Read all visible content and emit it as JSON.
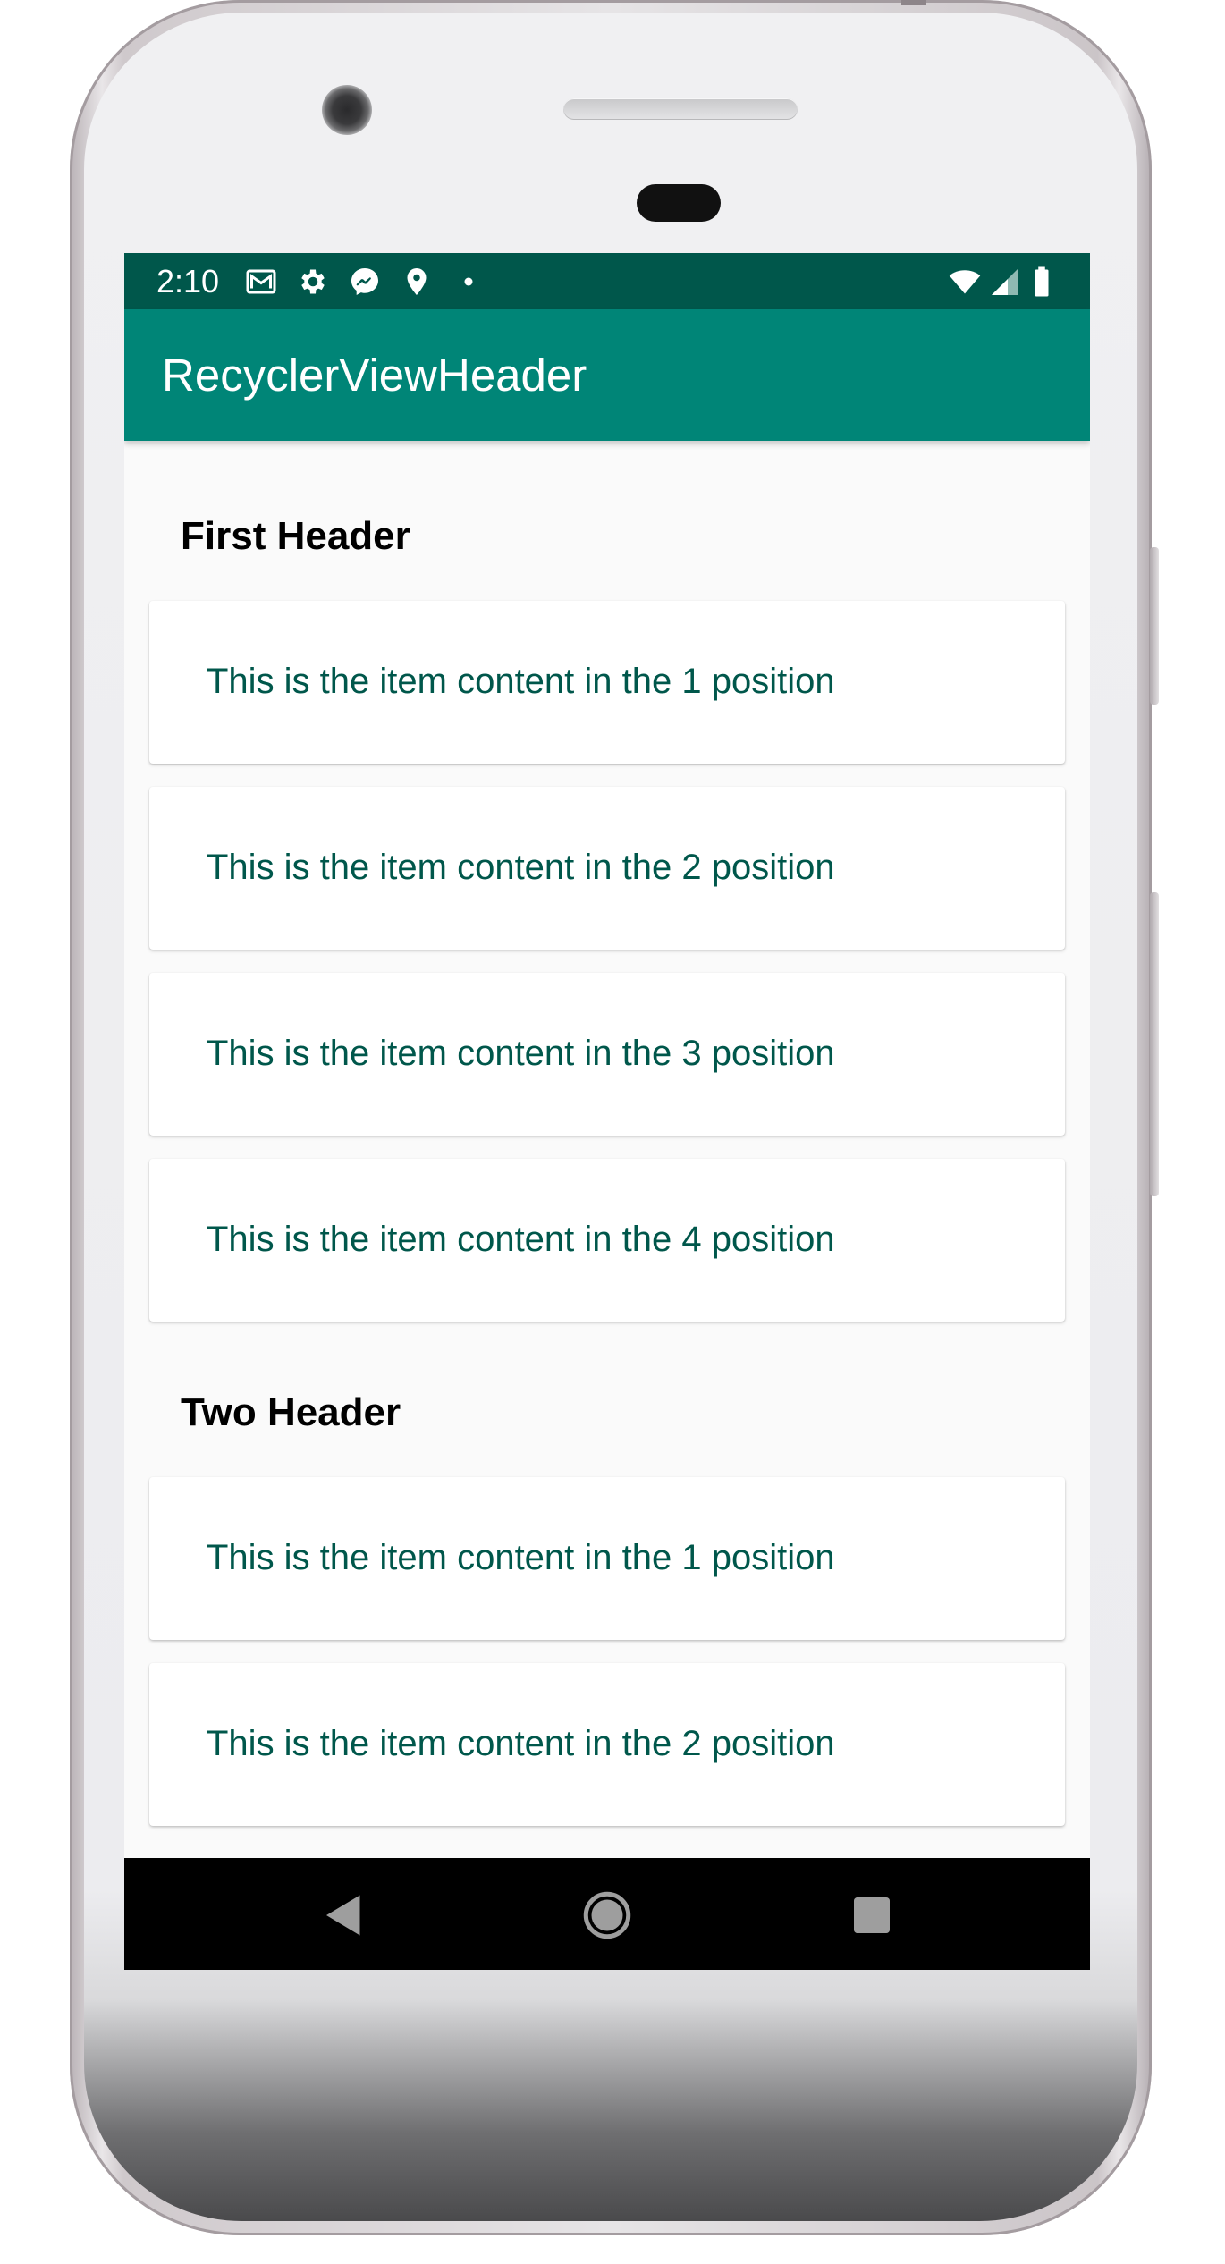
{
  "status_bar": {
    "time": "2:10",
    "left_icons": [
      "gmail-icon",
      "settings-icon",
      "messenger-icon",
      "location-icon",
      "dot-icon"
    ],
    "right_icons": [
      "wifi-icon",
      "signal-icon",
      "battery-icon"
    ],
    "background_color": "#00574b"
  },
  "app_bar": {
    "title": "RecyclerViewHeader",
    "background_color": "#008577"
  },
  "sections": [
    {
      "header": "First Header",
      "items": [
        "This is the item content in the 1 position",
        "This is the item content in the 2 position",
        "This is the item content in the 3 position",
        "This is the item content in the 4 position"
      ]
    },
    {
      "header": "Two Header",
      "items": [
        "This is the item content in the 1 position",
        "This is the item content in the 2 position"
      ]
    }
  ],
  "colors": {
    "item_text": "#00574b",
    "header_text": "#000000",
    "list_background": "#fafafa"
  },
  "nav_bar": {
    "buttons": [
      "back-icon",
      "home-icon",
      "recents-icon"
    ]
  }
}
